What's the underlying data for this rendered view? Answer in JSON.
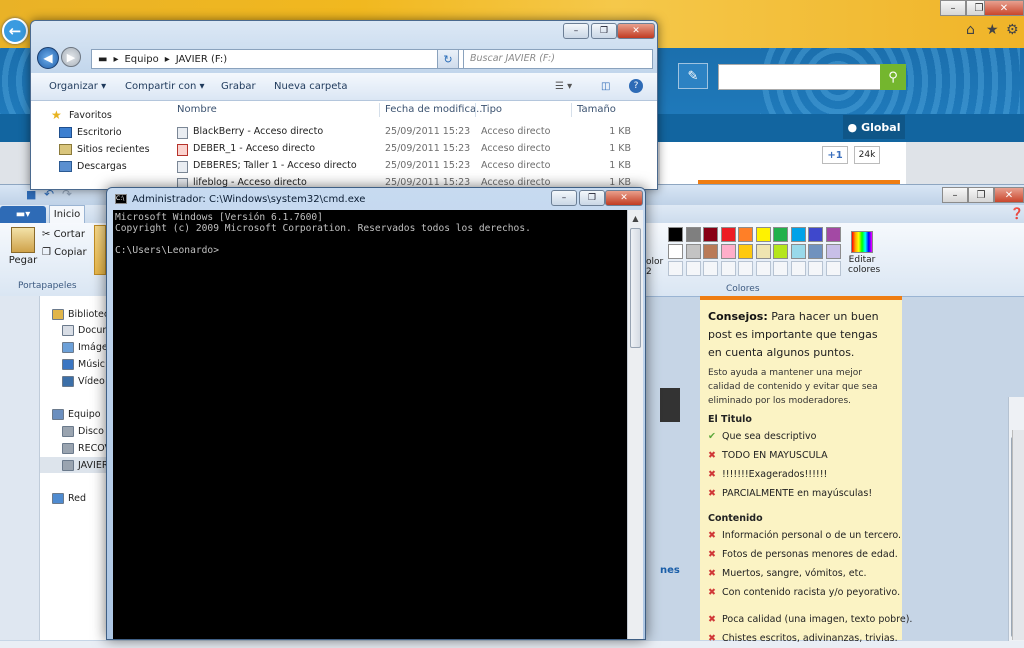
{
  "browser": {
    "back_icon": "back-arrow-icon",
    "global_label": "Global",
    "plus_one": "+1",
    "plus_count": "24k",
    "nes_fragment": "nes",
    "accent_orange": "#ef7d12",
    "banner_blue": "#1b6fad"
  },
  "explorer": {
    "address": [
      "Equipo",
      "JAVIER (F:)"
    ],
    "search_placeholder": "Buscar JAVIER (F:)",
    "toolbar": [
      "Organizar",
      "Compartir con",
      "Grabar",
      "Nueva carpeta"
    ],
    "nav": [
      "Favoritos",
      "Escritorio",
      "Sitios recientes",
      "Descargas"
    ],
    "columns": [
      "Nombre",
      "Fecha de modifica...",
      "Tipo",
      "Tamaño"
    ],
    "files": [
      {
        "name": "BlackBerry - Acceso directo",
        "date": "25/09/2011 15:23",
        "type": "Acceso directo",
        "size": "1 KB"
      },
      {
        "name": "DEBER_1 - Acceso directo",
        "date": "25/09/2011 15:23",
        "type": "Acceso directo",
        "size": "1 KB"
      },
      {
        "name": "DEBERES; Taller 1 - Acceso directo",
        "date": "25/09/2011 15:23",
        "type": "Acceso directo",
        "size": "1 KB"
      },
      {
        "name": "lifeblog - Acceso directo",
        "date": "25/09/2011 15:23",
        "type": "Acceso directo",
        "size": "1 KB"
      }
    ]
  },
  "paint": {
    "tab_home": "Inicio",
    "paste": "Pegar",
    "cut": "Cortar",
    "copy": "Copiar",
    "group_clipboard": "Portapapeles",
    "group_colors": "Colores",
    "color_label": "olor\n2",
    "edit_colors": "Editar colores",
    "palette_row1": [
      "#000000",
      "#7f7f7f",
      "#880015",
      "#ed1c24",
      "#ff7f27",
      "#fff200",
      "#22b14c",
      "#00a2e8",
      "#3f48cc",
      "#a349a4"
    ],
    "palette_row2": [
      "#ffffff",
      "#c3c3c3",
      "#b97a57",
      "#ffaec9",
      "#ffc90e",
      "#efe4b0",
      "#b5e61d",
      "#99d9ea",
      "#7092be",
      "#c8bfe7"
    ]
  },
  "left_nav": [
    "Bibliotec",
    "Docum",
    "Imáge",
    "Músic",
    "Vídeo",
    "Equipo",
    "Disco",
    "RECOV",
    "JAVIER",
    "Red"
  ],
  "tips": {
    "intro_bold": "Consejos:",
    "intro": " Para hacer un buen post es importante que tengas en cuenta algunos puntos.",
    "small": "Esto ayuda a mantener una mejor calidad de contenido y evitar que sea eliminado por los moderadores.",
    "title_section": "El Titulo",
    "title_items": [
      {
        "ok": true,
        "text": "Que sea descriptivo"
      },
      {
        "ok": false,
        "text": "TODO EN MAYUSCULA"
      },
      {
        "ok": false,
        "text": "!!!!!!!Exagerados!!!!!!"
      },
      {
        "ok": false,
        "text": "PARCIALMENTE en mayúsculas!"
      }
    ],
    "content_section": "Contenido",
    "content_items": [
      {
        "ok": false,
        "text": "Información personal o de un tercero."
      },
      {
        "ok": false,
        "text": "Fotos de personas menores de edad."
      },
      {
        "ok": false,
        "text": "Muertos, sangre, vómitos, etc."
      },
      {
        "ok": false,
        "text": "Con contenido racista y/o peyorativo."
      },
      {
        "ok": false,
        "text": "Poca calidad (una imagen, texto pobre)."
      },
      {
        "ok": false,
        "text": "Chistes escritos, adivinanzas, trivias."
      }
    ]
  },
  "cmd": {
    "title": "Administrador: C:\\Windows\\system32\\cmd.exe",
    "lines": [
      "Microsoft Windows [Versión 6.1.7600]",
      "Copyright (c) 2009 Microsoft Corporation. Reservados todos los derechos.",
      "",
      "C:\\Users\\Leonardo>"
    ]
  }
}
